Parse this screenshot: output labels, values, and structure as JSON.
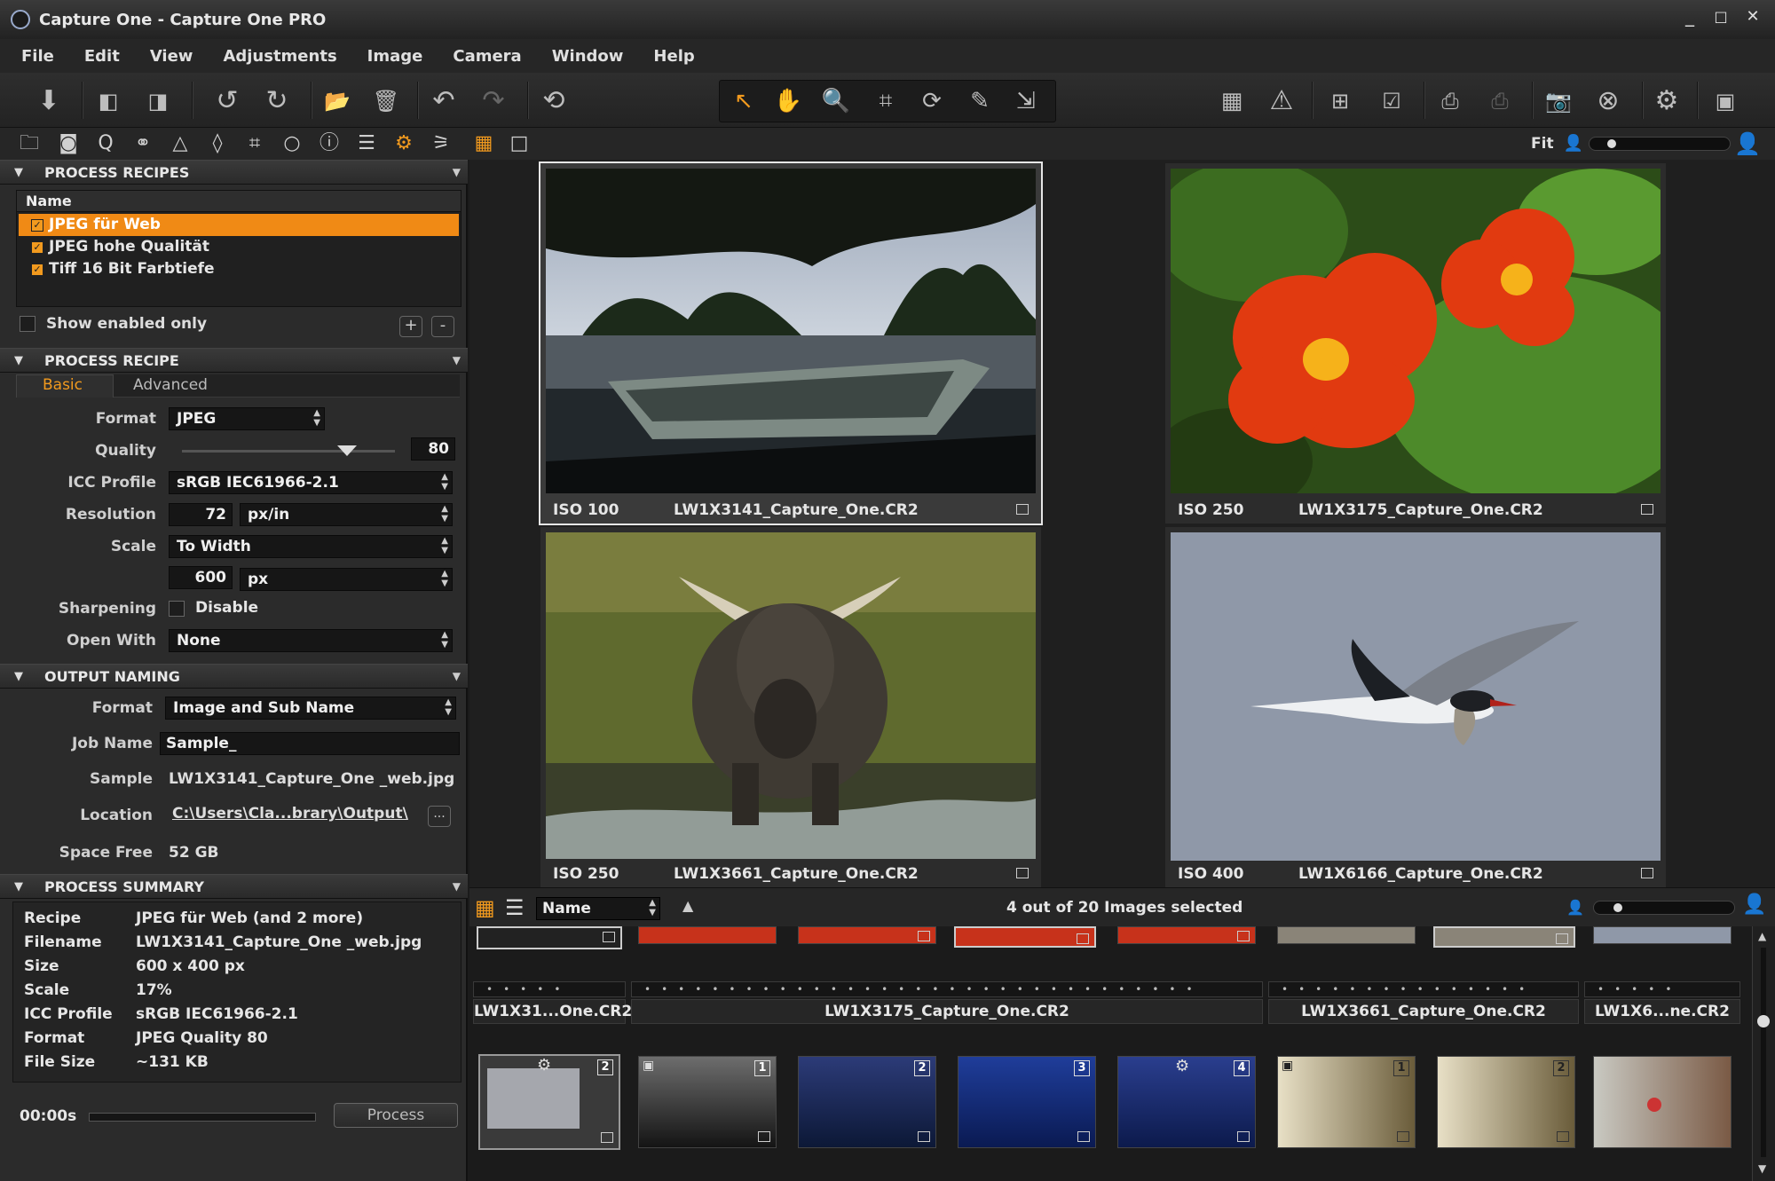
{
  "window": {
    "title": "Capture One - Capture One PRO",
    "controls": [
      "_",
      "□",
      "✕"
    ]
  },
  "menus": [
    "File",
    "Edit",
    "View",
    "Adjustments",
    "Image",
    "Camera",
    "Window",
    "Help"
  ],
  "toolbar": {
    "icons": [
      "import-icon",
      "previous-variant-icon",
      "next-variant-icon",
      "rotate-left-icon",
      "rotate-right-icon",
      "move-to-folder-icon",
      "delete-icon",
      "undo-icon",
      "redo-icon",
      "reset-icon",
      "cursor-icon",
      "hand-icon",
      "zoom-icon",
      "crop-icon",
      "rotate-tool-icon",
      "picker-icon",
      "keystone-icon",
      "grid-icon",
      "exposure-warning-icon",
      "new-variant-icon",
      "clone-variant-icon",
      "process-icon",
      "batch-process-icon",
      "camera-icon",
      "close-icon",
      "settings-icon",
      "tethered-icon"
    ]
  },
  "tooltabs": {
    "fit_label": "Fit"
  },
  "process_recipes": {
    "header": "PROCESS RECIPES",
    "column_name": "Name",
    "items": [
      {
        "label": "JPEG für Web",
        "checked": true,
        "selected": true
      },
      {
        "label": "JPEG hohe Qualität",
        "checked": true,
        "selected": false
      },
      {
        "label": "Tiff 16 Bit Farbtiefe",
        "checked": true,
        "selected": false
      }
    ],
    "show_enabled_only": "Show enabled only",
    "add_label": "+",
    "remove_label": "-"
  },
  "process_recipe": {
    "header": "PROCESS RECIPE",
    "tabs": [
      "Basic",
      "Advanced"
    ],
    "format_label": "Format",
    "format_value": "JPEG",
    "quality_label": "Quality",
    "quality_value": "80",
    "icc_label": "ICC Profile",
    "icc_value": "sRGB IEC61966-2.1",
    "resolution_label": "Resolution",
    "resolution_value": "72",
    "resolution_unit": "px/in",
    "scale_label": "Scale",
    "scale_value": "To Width",
    "scale_amount": "600",
    "scale_unit": "px",
    "sharpening_label": "Sharpening",
    "sharpening_value": "Disable",
    "open_with_label": "Open With",
    "open_with_value": "None"
  },
  "output_naming": {
    "header": "OUTPUT NAMING",
    "format_label": "Format",
    "format_value": "Image and Sub Name",
    "job_name_label": "Job Name",
    "job_name_value": "Sample_",
    "sample_label": "Sample",
    "sample_value": "LW1X3141_Capture_One _web.jpg",
    "location_label": "Location",
    "location_value": "C:\\Users\\Cla...brary\\Output\\",
    "browse_label": "...",
    "space_free_label": "Space Free",
    "space_free_value": "52 GB"
  },
  "process_summary": {
    "header": "PROCESS SUMMARY",
    "rows": [
      {
        "label": "Recipe",
        "value": "JPEG für Web  (and 2 more)"
      },
      {
        "label": "Filename",
        "value": "LW1X3141_Capture_One _web.jpg"
      },
      {
        "label": "Size",
        "value": "600  x  400   px"
      },
      {
        "label": "Scale",
        "value": "17%"
      },
      {
        "label": "ICC Profile",
        "value": "sRGB IEC61966-2.1"
      },
      {
        "label": "Format",
        "value": "JPEG Quality 80"
      },
      {
        "label": "File Size",
        "value": "~131 KB"
      }
    ],
    "timer": "00:00s",
    "process_button": "Process"
  },
  "viewer": {
    "images": [
      {
        "iso": "ISO 100",
        "filename": "LW1X3141_Capture_One.CR2",
        "subject": "boat-lake",
        "selected": true
      },
      {
        "iso": "ISO 250",
        "filename": "LW1X3175_Capture_One.CR2",
        "subject": "nasturtium-flowers",
        "selected": false
      },
      {
        "iso": "ISO 250",
        "filename": "LW1X3661_Capture_One.CR2",
        "subject": "moose",
        "selected": false
      },
      {
        "iso": "ISO 400",
        "filename": "LW1X6166_Capture_One.CR2",
        "subject": "tern-with-fish",
        "selected": false
      }
    ]
  },
  "browser": {
    "sort_value": "Name",
    "count_text": "4 out of 20 Images selected",
    "groups": [
      {
        "name": "LW1X31...One.CR2"
      },
      {
        "name": "LW1X3175_Capture_One.CR2"
      },
      {
        "name": "LW1X3661_Capture_One.CR2"
      },
      {
        "name": "LW1X6...ne.CR2"
      }
    ],
    "thumbs": [
      {
        "num": "2",
        "kind": "bird-grey"
      },
      {
        "num": "1",
        "kind": "bw-landscape"
      },
      {
        "num": "2",
        "kind": "blue-mountains"
      },
      {
        "num": "3",
        "kind": "blue-mountains"
      },
      {
        "num": "4",
        "kind": "blue-mountains"
      },
      {
        "num": "1",
        "kind": "gannet"
      },
      {
        "num": "2",
        "kind": "gannet"
      },
      {
        "num": "",
        "kind": "hummingbird"
      }
    ]
  },
  "colors": {
    "accent": "#f08a15",
    "panel": "#2b2b2b",
    "viewer_bg": "#1f1f1f"
  }
}
